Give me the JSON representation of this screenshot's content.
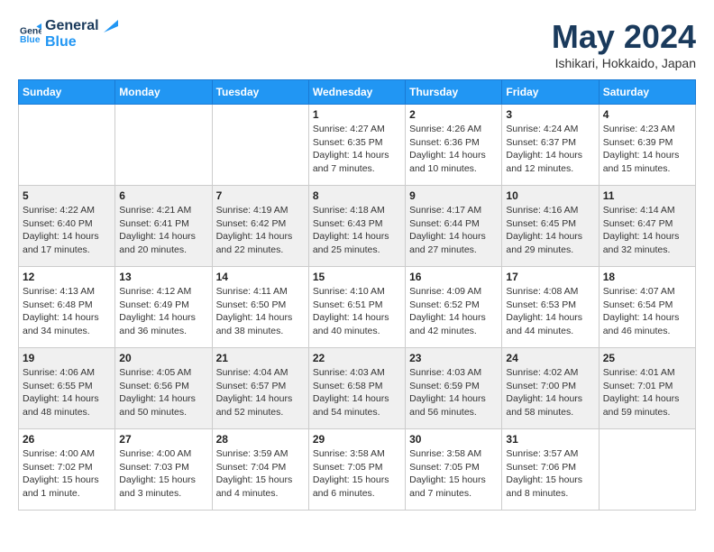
{
  "logo": {
    "line1": "General",
    "line2": "Blue"
  },
  "title": "May 2024",
  "location": "Ishikari, Hokkaido, Japan",
  "weekdays": [
    "Sunday",
    "Monday",
    "Tuesday",
    "Wednesday",
    "Thursday",
    "Friday",
    "Saturday"
  ],
  "weeks": [
    [
      {
        "day": "",
        "info": ""
      },
      {
        "day": "",
        "info": ""
      },
      {
        "day": "",
        "info": ""
      },
      {
        "day": "1",
        "info": "Sunrise: 4:27 AM\nSunset: 6:35 PM\nDaylight: 14 hours\nand 7 minutes."
      },
      {
        "day": "2",
        "info": "Sunrise: 4:26 AM\nSunset: 6:36 PM\nDaylight: 14 hours\nand 10 minutes."
      },
      {
        "day": "3",
        "info": "Sunrise: 4:24 AM\nSunset: 6:37 PM\nDaylight: 14 hours\nand 12 minutes."
      },
      {
        "day": "4",
        "info": "Sunrise: 4:23 AM\nSunset: 6:39 PM\nDaylight: 14 hours\nand 15 minutes."
      }
    ],
    [
      {
        "day": "5",
        "info": "Sunrise: 4:22 AM\nSunset: 6:40 PM\nDaylight: 14 hours\nand 17 minutes."
      },
      {
        "day": "6",
        "info": "Sunrise: 4:21 AM\nSunset: 6:41 PM\nDaylight: 14 hours\nand 20 minutes."
      },
      {
        "day": "7",
        "info": "Sunrise: 4:19 AM\nSunset: 6:42 PM\nDaylight: 14 hours\nand 22 minutes."
      },
      {
        "day": "8",
        "info": "Sunrise: 4:18 AM\nSunset: 6:43 PM\nDaylight: 14 hours\nand 25 minutes."
      },
      {
        "day": "9",
        "info": "Sunrise: 4:17 AM\nSunset: 6:44 PM\nDaylight: 14 hours\nand 27 minutes."
      },
      {
        "day": "10",
        "info": "Sunrise: 4:16 AM\nSunset: 6:45 PM\nDaylight: 14 hours\nand 29 minutes."
      },
      {
        "day": "11",
        "info": "Sunrise: 4:14 AM\nSunset: 6:47 PM\nDaylight: 14 hours\nand 32 minutes."
      }
    ],
    [
      {
        "day": "12",
        "info": "Sunrise: 4:13 AM\nSunset: 6:48 PM\nDaylight: 14 hours\nand 34 minutes."
      },
      {
        "day": "13",
        "info": "Sunrise: 4:12 AM\nSunset: 6:49 PM\nDaylight: 14 hours\nand 36 minutes."
      },
      {
        "day": "14",
        "info": "Sunrise: 4:11 AM\nSunset: 6:50 PM\nDaylight: 14 hours\nand 38 minutes."
      },
      {
        "day": "15",
        "info": "Sunrise: 4:10 AM\nSunset: 6:51 PM\nDaylight: 14 hours\nand 40 minutes."
      },
      {
        "day": "16",
        "info": "Sunrise: 4:09 AM\nSunset: 6:52 PM\nDaylight: 14 hours\nand 42 minutes."
      },
      {
        "day": "17",
        "info": "Sunrise: 4:08 AM\nSunset: 6:53 PM\nDaylight: 14 hours\nand 44 minutes."
      },
      {
        "day": "18",
        "info": "Sunrise: 4:07 AM\nSunset: 6:54 PM\nDaylight: 14 hours\nand 46 minutes."
      }
    ],
    [
      {
        "day": "19",
        "info": "Sunrise: 4:06 AM\nSunset: 6:55 PM\nDaylight: 14 hours\nand 48 minutes."
      },
      {
        "day": "20",
        "info": "Sunrise: 4:05 AM\nSunset: 6:56 PM\nDaylight: 14 hours\nand 50 minutes."
      },
      {
        "day": "21",
        "info": "Sunrise: 4:04 AM\nSunset: 6:57 PM\nDaylight: 14 hours\nand 52 minutes."
      },
      {
        "day": "22",
        "info": "Sunrise: 4:03 AM\nSunset: 6:58 PM\nDaylight: 14 hours\nand 54 minutes."
      },
      {
        "day": "23",
        "info": "Sunrise: 4:03 AM\nSunset: 6:59 PM\nDaylight: 14 hours\nand 56 minutes."
      },
      {
        "day": "24",
        "info": "Sunrise: 4:02 AM\nSunset: 7:00 PM\nDaylight: 14 hours\nand 58 minutes."
      },
      {
        "day": "25",
        "info": "Sunrise: 4:01 AM\nSunset: 7:01 PM\nDaylight: 14 hours\nand 59 minutes."
      }
    ],
    [
      {
        "day": "26",
        "info": "Sunrise: 4:00 AM\nSunset: 7:02 PM\nDaylight: 15 hours\nand 1 minute."
      },
      {
        "day": "27",
        "info": "Sunrise: 4:00 AM\nSunset: 7:03 PM\nDaylight: 15 hours\nand 3 minutes."
      },
      {
        "day": "28",
        "info": "Sunrise: 3:59 AM\nSunset: 7:04 PM\nDaylight: 15 hours\nand 4 minutes."
      },
      {
        "day": "29",
        "info": "Sunrise: 3:58 AM\nSunset: 7:05 PM\nDaylight: 15 hours\nand 6 minutes."
      },
      {
        "day": "30",
        "info": "Sunrise: 3:58 AM\nSunset: 7:05 PM\nDaylight: 15 hours\nand 7 minutes."
      },
      {
        "day": "31",
        "info": "Sunrise: 3:57 AM\nSunset: 7:06 PM\nDaylight: 15 hours\nand 8 minutes."
      },
      {
        "day": "",
        "info": ""
      }
    ]
  ]
}
